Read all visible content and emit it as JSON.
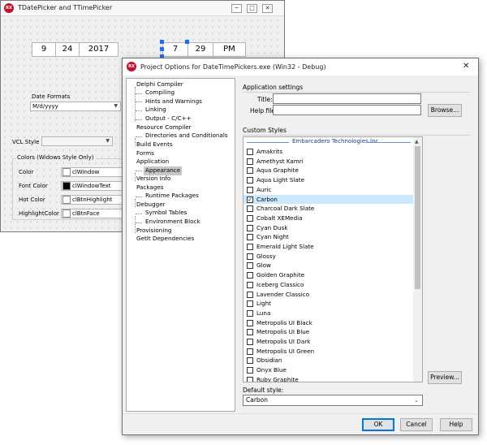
{
  "back_window": {
    "title": "TDatePicker and TTimePicker",
    "icon_text": "RX",
    "date_picker": {
      "day": "9",
      "month": "24",
      "year": "2017"
    },
    "time_picker": {
      "hour": "7",
      "minute": "29",
      "ampm": "PM"
    },
    "date_formats_label": "Date Formats",
    "date_format_value": "M/d/yyyy",
    "vcl_style_label": "VCL Style",
    "vcl_style_value": "",
    "colors_group_title": "Colors (Widows Style Only)",
    "color_rows": [
      {
        "label": "Color",
        "value": "clWindow",
        "swatch": "#ffffff"
      },
      {
        "label": "Font Color",
        "value": "clWindowText",
        "swatch": "#000000"
      },
      {
        "label": "Hot Color",
        "value": "clBtnHighlight",
        "swatch": "#ffffff"
      },
      {
        "label": "HighlightColor",
        "value": "clBtnFace",
        "swatch": "#ffffff"
      }
    ]
  },
  "dialog": {
    "title": "Project Options for DateTimePickers.exe  (Win32 - Debug)",
    "icon_text": "RX",
    "close_glyph": "✕",
    "tree": {
      "delphi_compiler": "Delphi Compiler",
      "compiling": "Compiling",
      "hints": "Hints and Warnings",
      "linking": "Linking",
      "output": "Output - C/C++",
      "resource_compiler": "Resource Compiler",
      "directories": "Directories and Conditionals",
      "build_events": "Build Events",
      "forms": "Forms",
      "application": "Application",
      "appearance": "Appearance",
      "version_info": "Version Info",
      "packages": "Packages",
      "runtime_packages": "Runtime Packages",
      "debugger": "Debugger",
      "symbol_tables": "Symbol Tables",
      "environment_block": "Environment Block",
      "provisioning": "Provisioning",
      "getit": "GetIt Dependencies"
    },
    "app_settings_title": "Application settings",
    "title_label": "Title:",
    "title_value": "",
    "help_file_label": "Help file:",
    "help_file_value": "",
    "browse_label": "Browse...",
    "custom_styles_title": "Custom Styles",
    "styles_header": "Embarcadero Technologies Inc.",
    "styles": [
      {
        "name": "Amakrits",
        "checked": false
      },
      {
        "name": "Amethyst Kamri",
        "checked": false
      },
      {
        "name": "Aqua Graphite",
        "checked": false
      },
      {
        "name": "Aqua Light Slate",
        "checked": false
      },
      {
        "name": "Auric",
        "checked": false
      },
      {
        "name": "Carbon",
        "checked": true
      },
      {
        "name": "Charcoal Dark Slate",
        "checked": false
      },
      {
        "name": "Cobalt XEMedia",
        "checked": false
      },
      {
        "name": "Cyan Dusk",
        "checked": false
      },
      {
        "name": "Cyan Night",
        "checked": false
      },
      {
        "name": "Emerald Light Slate",
        "checked": false
      },
      {
        "name": "Glossy",
        "checked": false
      },
      {
        "name": "Glow",
        "checked": false
      },
      {
        "name": "Golden Graphite",
        "checked": false
      },
      {
        "name": "Iceberg Classico",
        "checked": false
      },
      {
        "name": "Lavender Classico",
        "checked": false
      },
      {
        "name": "Light",
        "checked": false
      },
      {
        "name": "Luna",
        "checked": false
      },
      {
        "name": "Metropolis UI Black",
        "checked": false
      },
      {
        "name": "Metropolis UI Blue",
        "checked": false
      },
      {
        "name": "Metropolis UI Dark",
        "checked": false
      },
      {
        "name": "Metropolis UI Green",
        "checked": false
      },
      {
        "name": "Obsidian",
        "checked": false
      },
      {
        "name": "Onyx Blue",
        "checked": false
      },
      {
        "name": "Ruby Graphite",
        "checked": false
      }
    ],
    "selected_style": "Carbon",
    "preview_label": "Preview...",
    "default_style_label": "Default style:",
    "default_style_value": "Carbon",
    "ok_label": "OK",
    "cancel_label": "Cancel",
    "help_label": "Help"
  }
}
